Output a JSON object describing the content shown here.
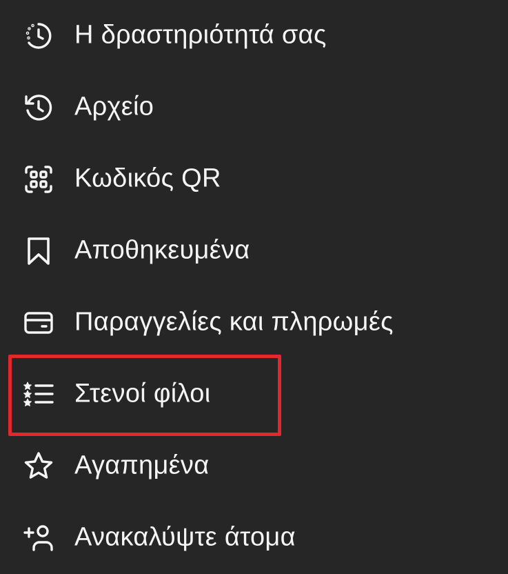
{
  "menu": {
    "items": [
      {
        "label": "Η δραστηριότητά σας",
        "icon": "activity-clock-icon"
      },
      {
        "label": "Αρχείο",
        "icon": "archive-history-icon"
      },
      {
        "label": "Κωδικός QR",
        "icon": "qr-code-icon"
      },
      {
        "label": "Αποθηκευμένα",
        "icon": "bookmark-icon"
      },
      {
        "label": "Παραγγελίες και πληρωμές",
        "icon": "card-icon"
      },
      {
        "label": "Στενοί φίλοι",
        "icon": "close-friends-list-icon"
      },
      {
        "label": "Αγαπημένα",
        "icon": "star-icon"
      },
      {
        "label": "Ανακαλύψτε άτομα",
        "icon": "add-person-icon"
      }
    ],
    "highlighted_item": "Στενοί φίλοι"
  },
  "colors": {
    "background": "#262626",
    "text": "#f5f5f5",
    "highlight": "#e0282e"
  }
}
